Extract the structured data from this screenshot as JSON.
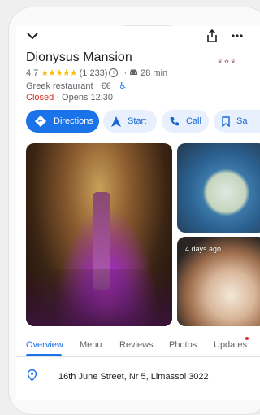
{
  "place": {
    "name": "Dionysus Mansion",
    "rating": "4,7",
    "reviews_count": "(1 233)",
    "drive_time": "28 min",
    "category": "Greek restaurant · €€ ·",
    "status_closed": "Closed",
    "status_opens": " · Opens 12:30"
  },
  "actions": {
    "directions": "Directions",
    "start": "Start",
    "call": "Call",
    "save": "Sa"
  },
  "photos": {
    "badge": "4 days ago"
  },
  "tabs": [
    "Overview",
    "Menu",
    "Reviews",
    "Photos",
    "Updates"
  ],
  "address": "16th June Street, Nr 5, Limassol 3022",
  "colors": {
    "accent": "#1a73e8",
    "closed": "#d93025",
    "star": "#fbbc04"
  }
}
